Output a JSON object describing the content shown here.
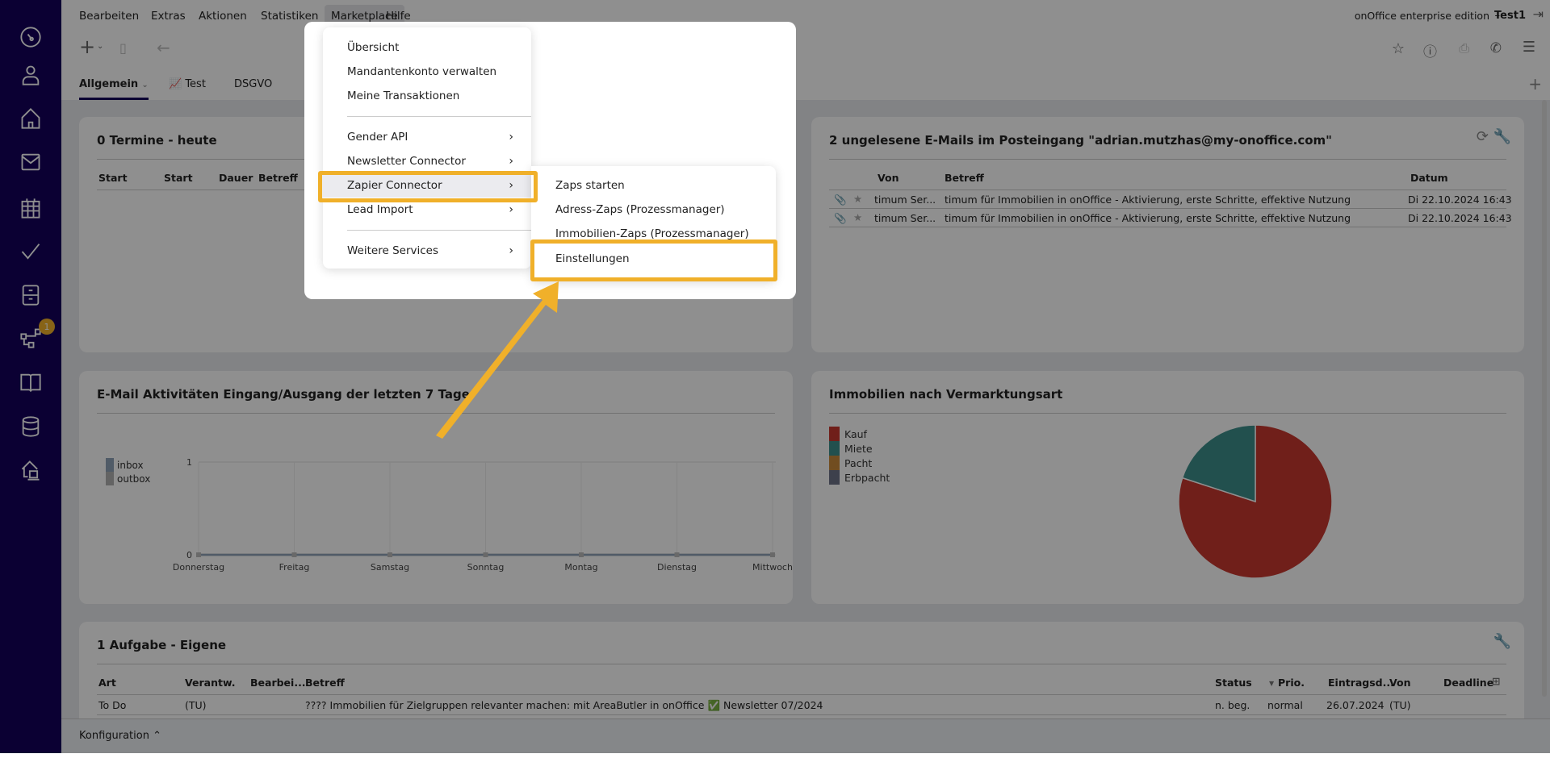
{
  "menubar": {
    "items": [
      "Bearbeiten",
      "Extras",
      "Aktionen",
      "Statistiken",
      "Marketplace",
      "Hilfe"
    ],
    "edition": "onOffice enterprise edition",
    "separator": "–",
    "user": "Test1"
  },
  "tabs": [
    {
      "label": "Allgemein",
      "active": true
    },
    {
      "label": "Test"
    },
    {
      "label": "DSGVO"
    }
  ],
  "sidebar": {
    "icons": [
      "dashboard-icon",
      "user-icon",
      "home-icon",
      "mail-icon",
      "calendar-icon",
      "check-icon",
      "file-cabinet-icon",
      "process-icon",
      "book-icon",
      "database-icon",
      "property-icon"
    ],
    "badge": "1"
  },
  "marketplace_menu": {
    "items": [
      {
        "label": "Übersicht"
      },
      {
        "label": "Mandantenkonto verwalten"
      },
      {
        "label": "Meine Transaktionen"
      },
      {
        "label": "Gender API",
        "submenu": true
      },
      {
        "label": "Newsletter Connector",
        "submenu": true
      },
      {
        "label": "Zapier Connector",
        "submenu": true,
        "highlighted": true
      },
      {
        "label": "Lead Import",
        "submenu": true
      },
      {
        "label": "Weitere Services",
        "submenu": true
      }
    ],
    "zapier_submenu": [
      {
        "label": "Zaps starten"
      },
      {
        "label": "Adress-Zaps (Prozessmanager)"
      },
      {
        "label": "Immobilien-Zaps (Prozessmanager)"
      },
      {
        "label": "Einstellungen",
        "highlighted": true
      }
    ]
  },
  "appointments": {
    "title": "0 Termine - heute",
    "columns": [
      "Start",
      "Start",
      "Dauer",
      "Betreff"
    ]
  },
  "emails": {
    "title": "2 ungelesene E-Mails im Posteingang \"adrian.mutzhas@my-onoffice.com\"",
    "columns": [
      "Von",
      "Betreff",
      "Datum"
    ],
    "rows": [
      {
        "from": "timum Ser...",
        "subject": "timum für Immobilien in onOffice - Aktivierung, erste Schritte, effektive Nutzung",
        "date": "Di 22.10.2024 16:43"
      },
      {
        "from": "timum Ser...",
        "subject": "timum für Immobilien in onOffice - Aktivierung, erste Schritte, effektive Nutzung",
        "date": "Di 22.10.2024 16:43"
      }
    ]
  },
  "chart_data": [
    {
      "type": "line",
      "title": "E-Mail Aktivitäten Eingang/Ausgang der letzten 7 Tage",
      "categories": [
        "Donnerstag",
        "Freitag",
        "Samstag",
        "Sonntag",
        "Montag",
        "Dienstag",
        "Mittwoch"
      ],
      "series": [
        {
          "name": "inbox",
          "values": [
            0,
            0,
            0,
            0,
            0,
            0,
            0
          ],
          "color": "#8fa3b8"
        },
        {
          "name": "outbox",
          "values": [
            0,
            0,
            0,
            0,
            0,
            0,
            0
          ],
          "color": "#b0b0b0"
        }
      ],
      "ylim": [
        0,
        1
      ],
      "yticks": [
        "0",
        "1"
      ],
      "legend": "top-left",
      "grid": true
    },
    {
      "type": "pie",
      "title": "Immobilien nach Vermarktungsart",
      "legend": "top-left",
      "slices": [
        {
          "name": "Kauf",
          "value": 80,
          "color": "#c8382f"
        },
        {
          "name": "Miete",
          "value": 20,
          "color": "#3e8f8c"
        },
        {
          "name": "Pacht",
          "value": 0,
          "color": "#c98a3a"
        },
        {
          "name": "Erbpacht",
          "value": 0,
          "color": "#6e7388"
        }
      ]
    }
  ],
  "tasks": {
    "title": "1 Aufgabe - Eigene",
    "columns": [
      "Art",
      "Verantw.",
      "Bearbei...",
      "Betreff",
      "Status",
      "Prio.",
      "Eintragsd...",
      "Von",
      "Deadline"
    ],
    "rows": [
      {
        "art": "To Do",
        "verantw": "(TU)",
        "bearb": "",
        "betreff": "???? Immobilien für Zielgruppen relevanter machen: mit AreaButler in onOffice",
        "check": "✅",
        "betreff2": "Newsletter 07/2024",
        "status": "n. beg.",
        "prio": "normal",
        "datum": "26.07.2024",
        "von": "(TU)",
        "deadline": ""
      }
    ]
  },
  "footer": {
    "label": "Konfiguration"
  },
  "colors": {
    "highlight": "#f0b02a",
    "sidebar": "#15005c"
  }
}
